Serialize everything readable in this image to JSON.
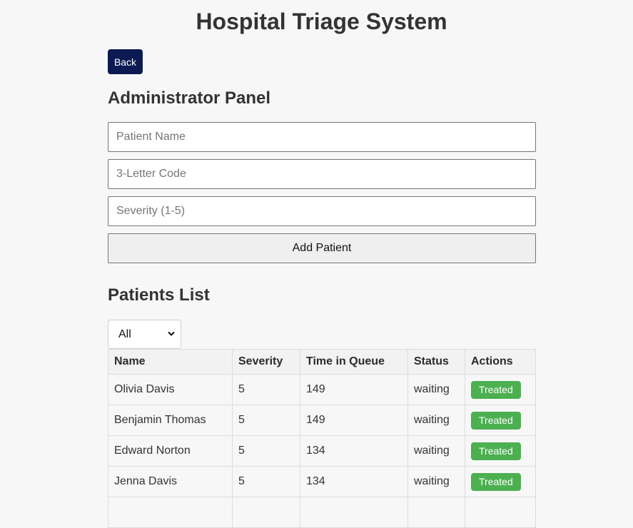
{
  "app": {
    "title": "Hospital Triage System"
  },
  "nav": {
    "back_label": "Back"
  },
  "admin_panel": {
    "title": "Administrator Panel",
    "name_placeholder": "Patient Name",
    "code_placeholder": "3-Letter Code",
    "severity_placeholder": "Severity (1-5)",
    "add_label": "Add Patient"
  },
  "patients": {
    "title": "Patients List",
    "filter_selected": "All",
    "columns": [
      "Name",
      "Severity",
      "Time in Queue",
      "Status",
      "Actions"
    ],
    "rows": [
      {
        "name": "Olivia Davis",
        "severity": "5",
        "time": "149",
        "status": "waiting",
        "action": "Treated"
      },
      {
        "name": "Benjamin Thomas",
        "severity": "5",
        "time": "149",
        "status": "waiting",
        "action": "Treated"
      },
      {
        "name": "Edward Norton",
        "severity": "5",
        "time": "134",
        "status": "waiting",
        "action": "Treated"
      },
      {
        "name": "Jenna Davis",
        "severity": "5",
        "time": "134",
        "status": "waiting",
        "action": "Treated"
      },
      {
        "name": "",
        "severity": "",
        "time": "",
        "status": "",
        "action": ""
      }
    ]
  },
  "icons": {
    "filter_chevron": "chevron-down-icon"
  },
  "colors": {
    "back_button": "#0b1a52",
    "treated_button": "#4caf50"
  }
}
